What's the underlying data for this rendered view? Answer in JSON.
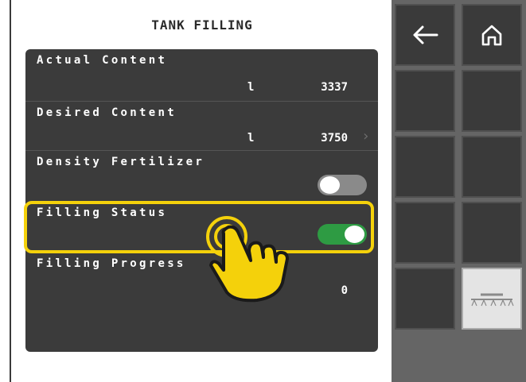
{
  "title": "TANK FILLING",
  "rows": {
    "actual": {
      "label": "Actual Content",
      "unit": "l",
      "value": "3337"
    },
    "desired": {
      "label": "Desired Content",
      "unit": "l",
      "value": "3750",
      "chevron": "›"
    },
    "density": {
      "label": "Density Fertilizer",
      "toggle": "off"
    },
    "status": {
      "label": "Filling Status",
      "toggle": "on"
    },
    "progress": {
      "label": "Filling Progress",
      "value": "0"
    }
  },
  "sidebar": {
    "icons": [
      "back-arrow-icon",
      "home-icon",
      "sprayer-boom-icon"
    ]
  },
  "colors": {
    "panel": "#3b3b3b",
    "toggle_on": "#2e9b43",
    "toggle_off": "#8a8a8a",
    "highlight": "#f4d10b",
    "sidebar": "#656565"
  }
}
